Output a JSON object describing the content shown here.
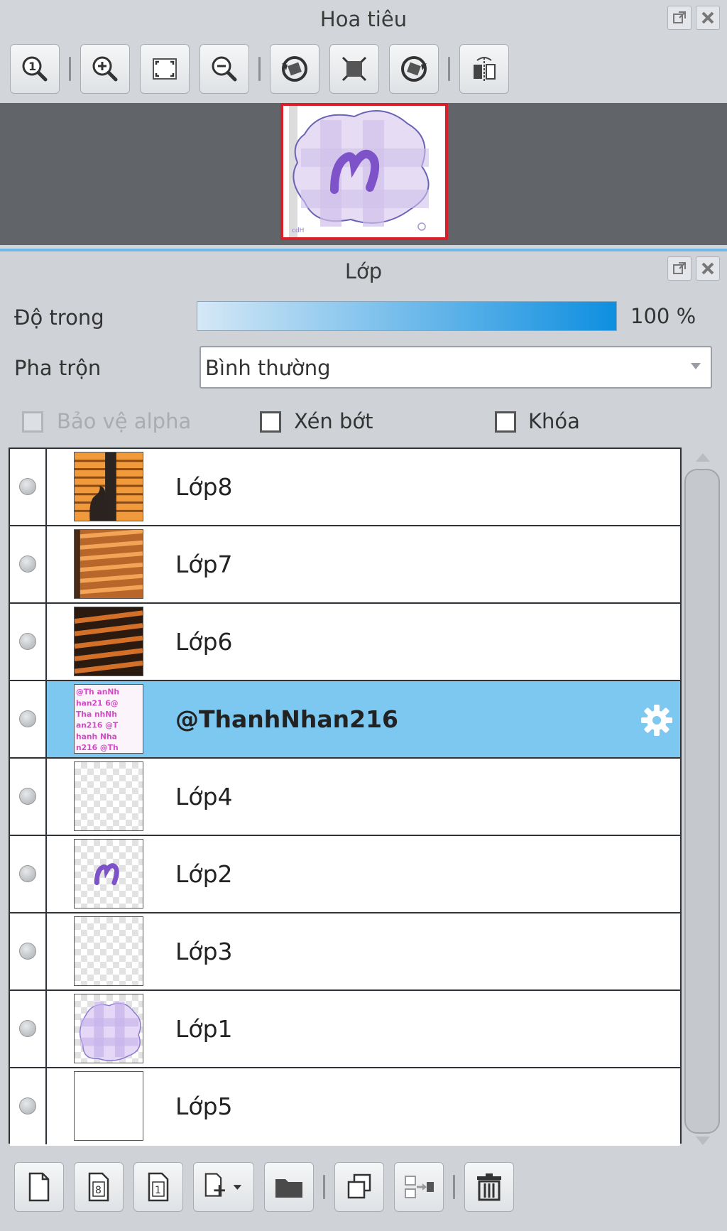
{
  "navigator": {
    "title": "Hoa tiêu",
    "toolbar_icons": [
      "zoom-actual-icon",
      "zoom-in-icon",
      "fit-screen-icon",
      "zoom-out-icon",
      "rotate-left-icon",
      "reset-view-icon",
      "rotate-right-icon",
      "flip-horizontal-icon"
    ]
  },
  "layers_panel": {
    "title": "Lớp",
    "opacity_label": "Độ trong",
    "opacity_value": "100 %",
    "opacity": 1.0,
    "blend_label": "Pha trộn",
    "blend_value": "Bình thường",
    "protect_alpha_label": "Bảo vệ alpha",
    "clipping_label": "Xén bớt",
    "lock_label": "Khóa",
    "layers": [
      {
        "name": "Lớp8",
        "thumb": "window-blinds-silhouette",
        "selected": false
      },
      {
        "name": "Lớp7",
        "thumb": "window-blinds-shadow",
        "selected": false
      },
      {
        "name": "Lớp6",
        "thumb": "dark-blinds-shadow",
        "selected": false
      },
      {
        "name": "@ThanhNhan216",
        "thumb": "pink-text-pattern",
        "selected": true
      },
      {
        "name": "Lớp4",
        "thumb": "transparent",
        "selected": false
      },
      {
        "name": "Lớp2",
        "thumb": "purple-n-logo",
        "selected": false
      },
      {
        "name": "Lớp3",
        "thumb": "transparent",
        "selected": false
      },
      {
        "name": "Lớp1",
        "thumb": "lavender-cloud",
        "selected": false
      },
      {
        "name": "Lớp5",
        "thumb": "white",
        "selected": false
      }
    ]
  },
  "bottom_toolbar_icons": [
    "new-layer-icon",
    "new-8bit-layer-icon",
    "new-1bit-layer-icon",
    "add-layer-menu-icon",
    "new-folder-icon",
    "duplicate-layer-icon",
    "merge-down-icon",
    "delete-layer-icon"
  ],
  "colors": {
    "selection": "#7cc8f0",
    "accent": "#0e8fe0",
    "nav_frame": "#d8202a"
  }
}
